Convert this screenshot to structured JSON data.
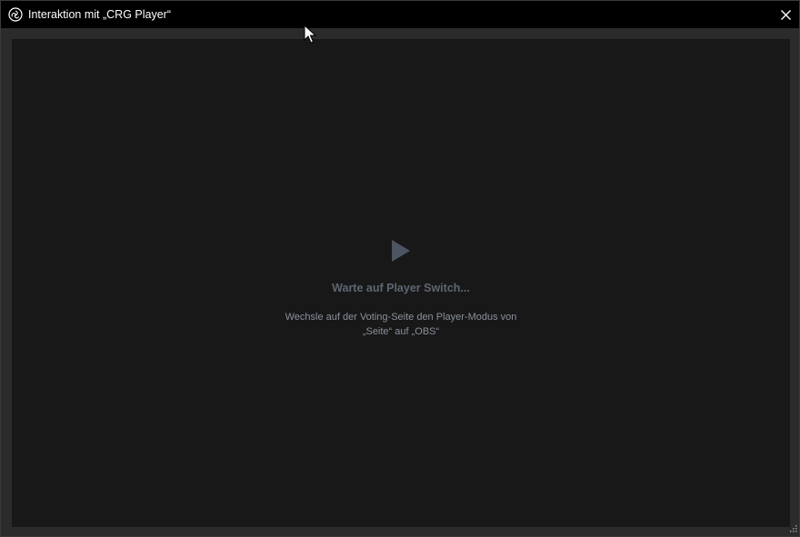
{
  "window": {
    "title": "Interaktion mit „CRG Player“",
    "icon": "obs-logo-icon",
    "close_icon": "close-icon"
  },
  "content": {
    "status_icon": "play-icon",
    "status_title": "Warte auf Player Switch...",
    "hint_line1": "Wechsle auf der Voting-Seite den Player-Modus von",
    "hint_line2": "„Seite“ auf „OBS“"
  },
  "colors": {
    "titlebar": "#000000",
    "frame": "#2b2b2b",
    "content_bg": "#181818",
    "play_icon": "#4d5462",
    "status_title": "#5f6572",
    "hint_text": "#8a909b"
  }
}
